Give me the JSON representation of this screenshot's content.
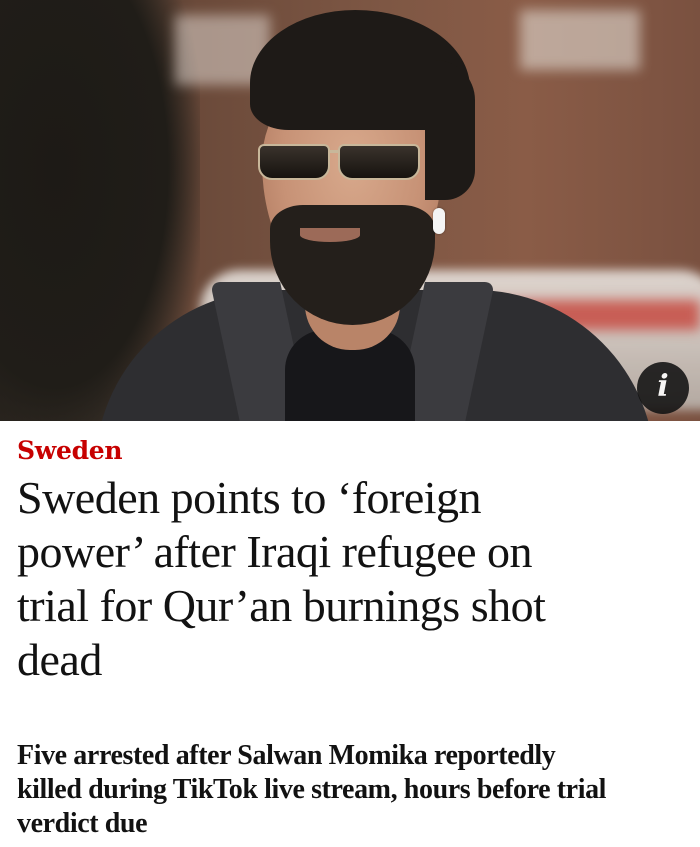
{
  "article": {
    "section": "Sweden",
    "headline_lines": [
      "Sweden points to ‘foreign",
      "power’ after Iraqi refugee on",
      "trial for Qur’an burnings shot",
      "dead"
    ],
    "standfirst_lines": [
      "Five arrested after Salwan Momika reportedly",
      "killed during TikTok live stream, hours before trial",
      "verdict due"
    ],
    "info_button_glyph": "i"
  },
  "hero_image": {
    "icons": [
      "info-icon"
    ]
  },
  "colors": {
    "section_accent": "#c70000",
    "text": "#121212",
    "background": "#ffffff",
    "info_button_bg": "#121212"
  }
}
